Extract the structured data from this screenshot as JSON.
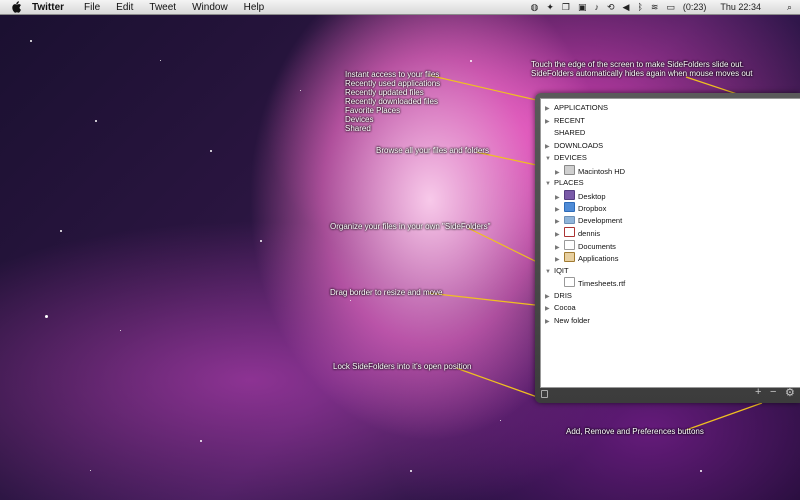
{
  "menubar": {
    "app_name": "Twitter",
    "menus": [
      "File",
      "Edit",
      "Tweet",
      "Window",
      "Help"
    ],
    "status_icons": [
      "globe-icon",
      "twitter-bird-icon",
      "windows-icon",
      "puzzle-icon",
      "music-icon",
      "time-machine-icon",
      "volume-icon",
      "bluetooth-icon",
      "wifi-icon",
      "battery-icon",
      "search-icon"
    ],
    "battery_time": "(0:23)",
    "clock": "Thu 22:34"
  },
  "annotations": {
    "edge": [
      "Touch the edge of the screen to make SideFolders slide out.",
      "SideFolders automatically hides again when mouse moves out"
    ],
    "instant": [
      "Instant access to your files",
      "Recently used applications",
      "Recently updated files",
      "Recently downloaded files",
      "Favorite Places",
      "Devices",
      "Shared"
    ],
    "browse": "Browse all your files and folders",
    "organize": "Organize your files in your own \"SideFolders\"",
    "drag": "Drag border to resize and move",
    "lock": "Lock SideFolders into it's open position",
    "buttons": "Add, Remove and Preferences buttons"
  },
  "tree": [
    {
      "label": "APPLICATIONS",
      "tri": "▶"
    },
    {
      "label": "RECENT",
      "tri": "▶"
    },
    {
      "label": "SHARED",
      "tri": ""
    },
    {
      "label": "DOWNLOADS",
      "tri": "▶"
    },
    {
      "label": "DEVICES",
      "tri": "▼"
    },
    {
      "label": "Macintosh HD",
      "tri": "▶"
    },
    {
      "label": "PLACES",
      "tri": "▼"
    },
    {
      "label": "Desktop",
      "tri": "▶"
    },
    {
      "label": "Dropbox",
      "tri": "▶"
    },
    {
      "label": "Development",
      "tri": "▶"
    },
    {
      "label": "dennis",
      "tri": "▶"
    },
    {
      "label": "Documents",
      "tri": "▶"
    },
    {
      "label": "Applications",
      "tri": "▶"
    },
    {
      "label": "IQIT",
      "tri": "▼"
    },
    {
      "label": "Timesheets.rtf",
      "tri": ""
    },
    {
      "label": "DRIS",
      "tri": "▶"
    },
    {
      "label": "Cocoa",
      "tri": "▶"
    },
    {
      "label": "New folder",
      "tri": "▶"
    }
  ],
  "bottom_buttons": {
    "add": "+",
    "remove": "−",
    "preferences": "⚙"
  },
  "colors": {
    "annotation_line": "#f0c020",
    "panel": "#4a4a4a"
  }
}
